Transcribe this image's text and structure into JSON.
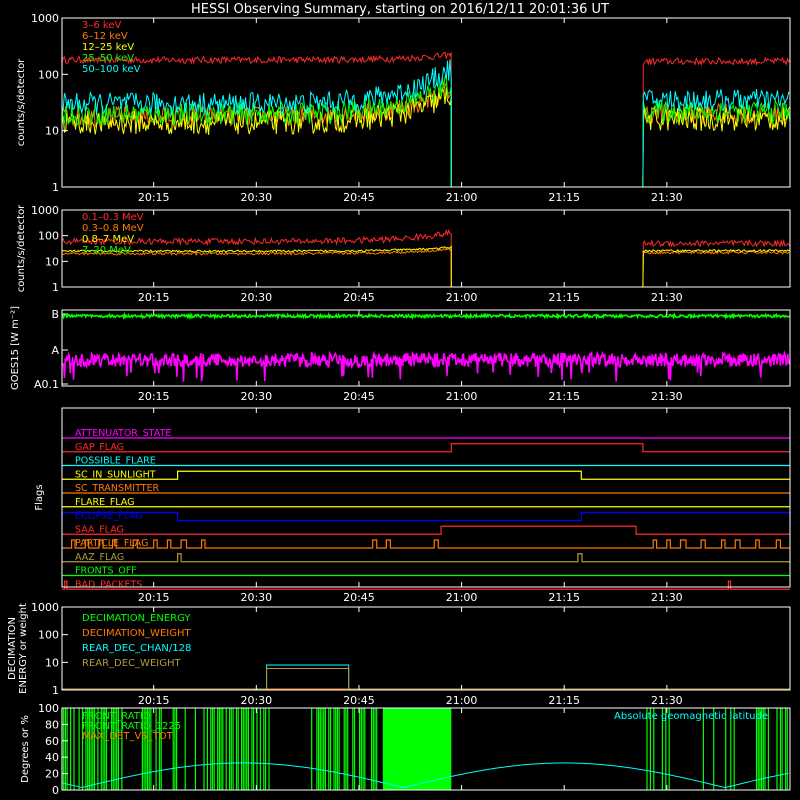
{
  "title": "HESSI Observing Summary, starting on 2016/12/11 20:01:36 UT",
  "colors": {
    "bg": "#000000",
    "axis": "#ffffff",
    "red": "#ff2a2a",
    "orange": "#ff7a00",
    "yellow": "#ffff00",
    "green": "#00ff00",
    "cyan": "#00ffff",
    "magenta": "#ff00ff",
    "blue": "#0000ff",
    "olive": "#b09a3c"
  },
  "time_axis": {
    "start_min": 1201.6,
    "end_min": 1308,
    "ticks": [
      "20:15",
      "20:30",
      "20:45",
      "21:00",
      "21:15",
      "21:30"
    ],
    "tick_min": [
      1215,
      1230,
      1245,
      1260,
      1275,
      1290
    ]
  },
  "chart_data": [
    {
      "type": "line",
      "ylabel": "counts/s/detector",
      "yscale": "log",
      "ylim": [
        1,
        1000
      ],
      "yticks": [
        "1",
        "10",
        "100",
        "1000"
      ],
      "gap": [
        1258.5,
        1286.5
      ],
      "series": [
        {
          "name": "3–6 keV",
          "color": "red",
          "start": 180,
          "end": 170,
          "pre_gap_end": 220,
          "noise": 0.06
        },
        {
          "name": "6–12 keV",
          "color": "orange",
          "start": 18,
          "end": 20,
          "pre_gap_end": 55,
          "noise": 0.18
        },
        {
          "name": "12–25 keV",
          "color": "yellow",
          "start": 14,
          "end": 16,
          "pre_gap_end": 45,
          "noise": 0.22
        },
        {
          "name": "25–50 keV",
          "color": "green",
          "start": 20,
          "end": 22,
          "pre_gap_end": 70,
          "noise": 0.2
        },
        {
          "name": "50–100 keV",
          "color": "cyan",
          "start": 30,
          "end": 35,
          "pre_gap_end": 130,
          "noise": 0.2
        }
      ]
    },
    {
      "type": "line",
      "ylabel": "counts/s/detector",
      "yscale": "log",
      "ylim": [
        1,
        1000
      ],
      "yticks": [
        "1",
        "10",
        "100",
        "1000"
      ],
      "gap": [
        1258.5,
        1286.5
      ],
      "series": [
        {
          "name": "0.1–0.3 MeV",
          "color": "red",
          "start": 60,
          "end": 50,
          "pre_gap_end": 130,
          "noise": 0.12
        },
        {
          "name": "0.3–0.8 MeV",
          "color": "orange",
          "start": 20,
          "end": 22,
          "pre_gap_end": 30,
          "noise": 0.05
        },
        {
          "name": "0.8–7 MeV",
          "color": "yellow",
          "start": 25,
          "end": 26,
          "pre_gap_end": 35,
          "noise": 0.04
        },
        {
          "name": "7–20 MeV",
          "color": "green",
          "start": 1,
          "end": 1,
          "pre_gap_end": 1,
          "noise": 0.0
        }
      ]
    },
    {
      "type": "line",
      "ylabel": "GOES15 [W m⁻²]",
      "yscale": "log",
      "yticks": [
        "A0.1",
        "A",
        "B"
      ],
      "series": [
        {
          "name": "GOES long",
          "color": "green",
          "level": "B"
        },
        {
          "name": "GOES short",
          "color": "magenta",
          "level": "A"
        }
      ]
    },
    {
      "type": "line",
      "ylabel": "Flags",
      "series": [
        {
          "name": "ATTENUATOR_STATE",
          "color": "magenta",
          "intervals": []
        },
        {
          "name": "GAP_FLAG",
          "color": "red",
          "intervals": [
            [
              1258.5,
              1286.5
            ]
          ]
        },
        {
          "name": "POSSIBLE_FLARE",
          "color": "cyan",
          "intervals": []
        },
        {
          "name": "SC_IN_SUNLIGHT",
          "color": "yellow",
          "intervals": [
            [
              1218.5,
              1277.5
            ]
          ]
        },
        {
          "name": "SC_TRANSMITTER",
          "color": "orange",
          "intervals": []
        },
        {
          "name": "FLARE_FLAG",
          "color": "yellow",
          "intervals": []
        },
        {
          "name": "ECLIPSE_FLAG",
          "color": "blue",
          "intervals": [
            [
              1201.6,
              1218.5
            ],
            [
              1277.5,
              1308
            ]
          ]
        },
        {
          "name": "SAA_FLAG",
          "color": "red",
          "intervals": [
            [
              1257,
              1285.5
            ]
          ]
        },
        {
          "name": "PARTICLE_FLAG",
          "color": "orange",
          "intervals": [
            [
              1203,
              1203.5
            ],
            [
              1205,
              1205.5
            ],
            [
              1207,
              1207.6
            ],
            [
              1209,
              1209.5
            ],
            [
              1212,
              1212.6
            ],
            [
              1215,
              1215.5
            ],
            [
              1217,
              1217.5
            ],
            [
              1219,
              1219.8
            ],
            [
              1222,
              1222.5
            ],
            [
              1247,
              1247.6
            ],
            [
              1249,
              1249.6
            ],
            [
              1256,
              1256.6
            ],
            [
              1288,
              1288.5
            ],
            [
              1290,
              1290.5
            ],
            [
              1292,
              1292.8
            ],
            [
              1295,
              1295.6
            ],
            [
              1298,
              1298.5
            ],
            [
              1300,
              1300.7
            ],
            [
              1303,
              1303.5
            ],
            [
              1306,
              1306.6
            ]
          ]
        },
        {
          "name": "AAZ_FLAG",
          "color": "olive",
          "intervals": [
            [
              1218.5,
              1219
            ],
            [
              1277,
              1277.6
            ]
          ]
        },
        {
          "name": "FRONTS_OFF",
          "color": "green",
          "intervals": []
        },
        {
          "name": "BAD_PACKETS",
          "color": "red",
          "intervals": [
            [
              1202,
              1202.3
            ],
            [
              1299,
              1299.3
            ]
          ]
        }
      ]
    },
    {
      "type": "line",
      "ylabel": "DECIMATION ENERGY or weight",
      "yscale": "log",
      "ylim": [
        1,
        1000
      ],
      "yticks": [
        "1",
        "10",
        "100",
        "1000"
      ],
      "series": [
        {
          "name": "DECIMATION_ENERGY",
          "color": "green",
          "value": 1
        },
        {
          "name": "DECIMATION_WEIGHT",
          "color": "orange",
          "value": 1
        },
        {
          "name": "REAR_DEC_CHAN/128",
          "color": "cyan",
          "value": 8,
          "interval": [
            1231.5,
            1243.5
          ]
        },
        {
          "name": "REAR_DEC_WEIGHT",
          "color": "olive",
          "value": 6,
          "interval": [
            1231.5,
            1243.5
          ]
        }
      ]
    },
    {
      "type": "line",
      "ylabel": "Degrees or %",
      "ylim": [
        0,
        100
      ],
      "yticks": [
        "0",
        "20",
        "40",
        "60",
        "80",
        "100"
      ],
      "annotation": "Absolute geomagnetic latitude",
      "series": [
        {
          "name": "FRONT_RATIO",
          "color": "green"
        },
        {
          "name": "FRONT_RATIO_1225",
          "color": "green"
        },
        {
          "name": "MAX_DET_VS_TOT",
          "color": "orange"
        },
        {
          "name": "Absolute geomagnetic latitude",
          "color": "cyan",
          "min": 3,
          "max": 33
        }
      ]
    }
  ]
}
